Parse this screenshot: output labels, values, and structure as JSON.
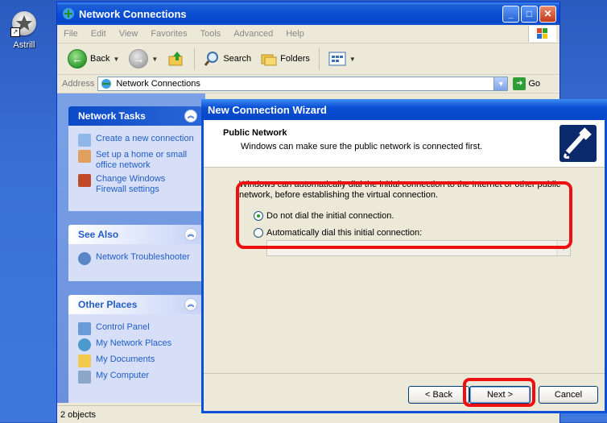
{
  "desktop": {
    "icon_label": "Astrill"
  },
  "window": {
    "title": "Network Connections"
  },
  "menu": [
    "File",
    "Edit",
    "View",
    "Favorites",
    "Tools",
    "Advanced",
    "Help"
  ],
  "toolbar": {
    "back": "Back",
    "search": "Search",
    "folders": "Folders"
  },
  "address": {
    "label": "Address",
    "value": "Network Connections",
    "go": "Go"
  },
  "left_panel": {
    "network_tasks": {
      "title": "Network Tasks",
      "items": [
        "Create a new connection",
        "Set up a home or small office network",
        "Change Windows Firewall settings"
      ]
    },
    "see_also": {
      "title": "See Also",
      "items": [
        "Network Troubleshooter"
      ]
    },
    "other_places": {
      "title": "Other Places",
      "items": [
        "Control Panel",
        "My Network Places",
        "My Documents",
        "My Computer"
      ]
    }
  },
  "status": {
    "text": "2 objects"
  },
  "wizard": {
    "title": "New Connection Wizard",
    "heading": "Public Network",
    "subheading": "Windows can make sure the public network is connected first.",
    "description": "Windows can automatically dial the initial connection to the Internet or other public network, before establishing the virtual connection.",
    "option_no_dial": "Do not dial the initial connection.",
    "option_auto_dial": "Automatically dial this initial connection:",
    "selected_option": "no_dial",
    "buttons": {
      "back": "< Back",
      "next": "Next >",
      "cancel": "Cancel"
    }
  }
}
